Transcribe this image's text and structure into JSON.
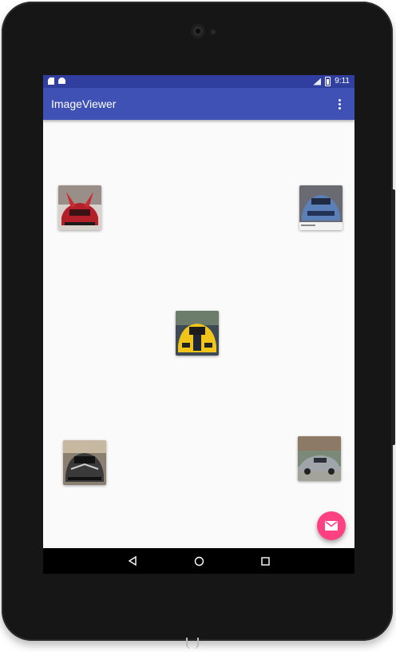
{
  "app": {
    "title": "ImageViewer"
  },
  "status_bar": {
    "time": "9:11",
    "icons": [
      "sd-card-icon",
      "android-icon",
      "signal-icon",
      "battery-icon"
    ]
  },
  "toolbar": {
    "menu_icon": "overflow-menu-icon"
  },
  "images": [
    {
      "name": "red-supercar",
      "color": "#b3202a"
    },
    {
      "name": "blue-supercar",
      "color": "#5b7fb8"
    },
    {
      "name": "yellow-supercar",
      "color": "#f0c419"
    },
    {
      "name": "black-supercar",
      "color": "#3a3a3a"
    },
    {
      "name": "silver-supercar",
      "color": "#9fa5ab"
    }
  ],
  "fab": {
    "icon": "mail-icon",
    "color": "#ff4081"
  },
  "navigation": {
    "buttons": [
      "back-icon",
      "home-icon",
      "recents-icon"
    ]
  },
  "colors": {
    "primary": "#3f51b5",
    "primary_dark": "#303f9f",
    "background": "#fafafa"
  }
}
